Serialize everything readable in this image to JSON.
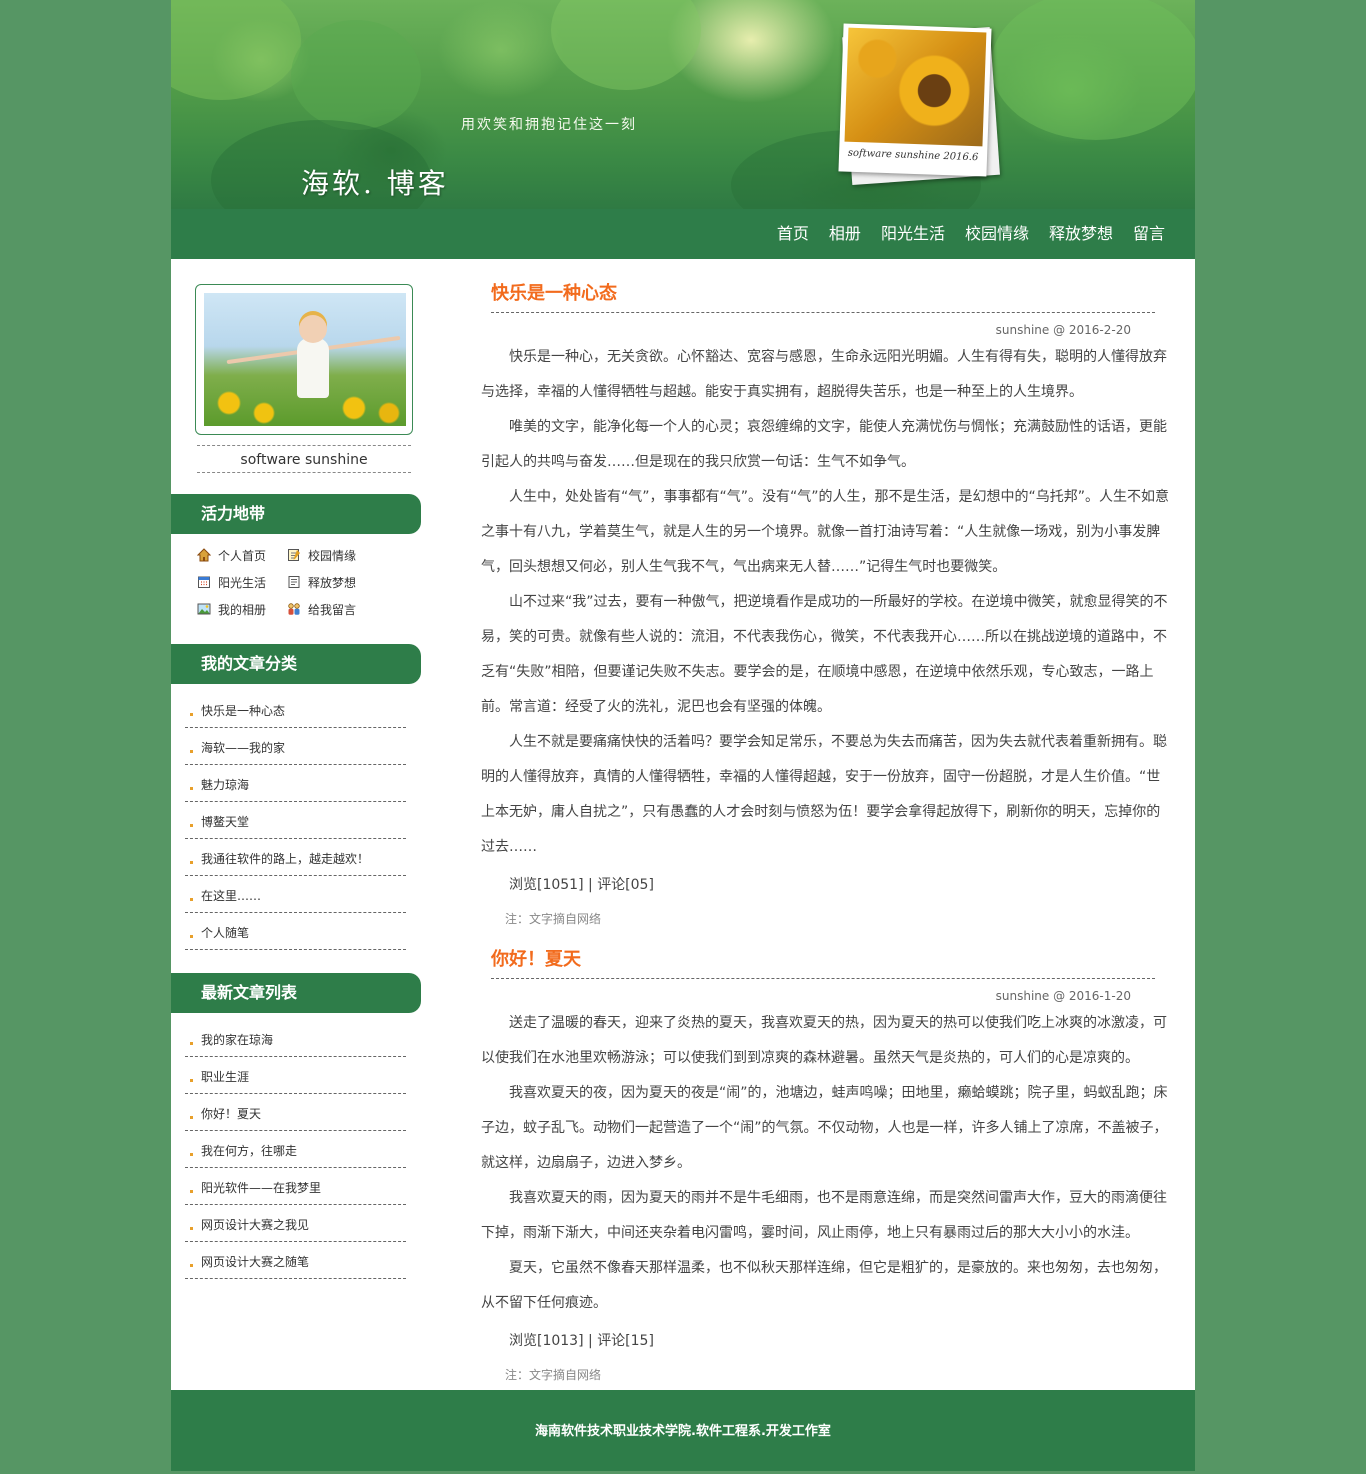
{
  "banner": {
    "slogan": "用欢笑和拥抱记住这一刻",
    "title": "海软. 博客",
    "polaroid_caption": "software sunshine  2016.6"
  },
  "nav": {
    "items": [
      "首页",
      "相册",
      "阳光生活",
      "校园情缘",
      "释放梦想",
      "留言"
    ]
  },
  "sidebar": {
    "profile_caption": "software sunshine",
    "vitality": {
      "heading": "活力地带",
      "links": [
        {
          "label": "个人首页",
          "icon": "home-icon"
        },
        {
          "label": "校园情缘",
          "icon": "notebook-icon"
        },
        {
          "label": "阳光生活",
          "icon": "calendar-icon"
        },
        {
          "label": "释放梦想",
          "icon": "document-icon"
        },
        {
          "label": "我的相册",
          "icon": "photo-icon"
        },
        {
          "label": "给我留言",
          "icon": "users-icon"
        }
      ]
    },
    "categories": {
      "heading": "我的文章分类",
      "items": [
        "快乐是一种心态",
        "海软——我的家",
        "魅力琼海",
        "博鳌天堂",
        "我通往软件的路上，越走越欢！",
        "在这里……",
        "个人随笔"
      ]
    },
    "latest": {
      "heading": "最新文章列表",
      "items": [
        "我的家在琼海",
        "职业生涯",
        "你好！夏天",
        "我在何方，往哪走",
        "阳光软件——在我梦里",
        "网页设计大赛之我见",
        "网页设计大赛之随笔"
      ]
    }
  },
  "articles": [
    {
      "title": "快乐是一种心态",
      "meta": "sunshine @ 2016-2-20",
      "paragraphs": [
        "快乐是一种心，无关贪欲。心怀豁达、宽容与感恩，生命永远阳光明媚。人生有得有失，聪明的人懂得放弃与选择，幸福的人懂得牺牲与超越。能安于真实拥有，超脱得失苦乐，也是一种至上的人生境界。",
        "唯美的文字，能净化每一个人的心灵；哀怨缠绵的文字，能使人充满忧伤与惆怅；充满鼓励性的话语，更能引起人的共鸣与奋发……但是现在的我只欣赏一句话：生气不如争气。",
        "人生中，处处皆有“气”，事事都有“气”。没有“气”的人生，那不是生活，是幻想中的“乌托邦”。人生不如意之事十有八九，学着莫生气，就是人生的另一个境界。就像一首打油诗写着：“人生就像一场戏，别为小事发脾气，回头想想又何必，别人生气我不气，气出病来无人替……”记得生气时也要微笑。",
        "山不过来“我”过去，要有一种傲气，把逆境看作是成功的一所最好的学校。在逆境中微笑，就愈显得笑的不易，笑的可贵。就像有些人说的：流泪，不代表我伤心，微笑，不代表我开心……所以在挑战逆境的道路中，不乏有“失败”相陪，但要谨记失败不失志。要学会的是，在顺境中感恩，在逆境中依然乐观，专心致志，一路上前。常言道：经受了火的洗礼，泥巴也会有坚强的体魄。",
        "人生不就是要痛痛快快的活着吗？要学会知足常乐，不要总为失去而痛苦，因为失去就代表着重新拥有。聪明的人懂得放弃，真情的人懂得牺牲，幸福的人懂得超越，安于一份放弃，固守一份超脱，才是人生价值。“世上本无妒，庸人自扰之”，只有愚蠢的人才会时刻与愤怒为伍！要学会拿得起放得下，刷新你的明天，忘掉你的过去……"
      ],
      "views": "浏览[1051]",
      "comments": "评论[05]",
      "separator": "|",
      "note": "注：文字摘自网络"
    },
    {
      "title": "你好！夏天",
      "meta": "sunshine @ 2016-1-20",
      "paragraphs": [
        "送走了温暖的春天，迎来了炎热的夏天，我喜欢夏天的热，因为夏天的热可以使我们吃上冰爽的冰激凌，可以使我们在水池里欢畅游泳；可以使我们到到凉爽的森林避暑。虽然天气是炎热的，可人们的心是凉爽的。",
        "我喜欢夏天的夜，因为夏天的夜是“闹”的，池塘边，蛙声鸣噪；田地里，癞蛤蟆跳；院子里，蚂蚁乱跑；床子边，蚊子乱飞。动物们一起营造了一个“闹”的气氛。不仅动物，人也是一样，许多人铺上了凉席，不盖被子，就这样，边扇扇子，边进入梦乡。",
        "我喜欢夏天的雨，因为夏天的雨并不是牛毛细雨，也不是雨意连绵，而是突然间雷声大作，豆大的雨滴便往下掉，雨渐下渐大，中间还夹杂着电闪雷鸣，霎时间，风止雨停，地上只有暴雨过后的那大大小小的水洼。",
        "夏天，它虽然不像春天那样温柔，也不似秋天那样连绵，但它是粗犷的，是豪放的。来也匆匆，去也匆匆，从不留下任何痕迹。"
      ],
      "views": "浏览[1013]",
      "comments": "评论[15]",
      "separator": "|",
      "note": "注：文字摘自网络"
    }
  ],
  "footer": {
    "text": "海南软件技术职业技术学院.软件工程系.开发工作室"
  }
}
